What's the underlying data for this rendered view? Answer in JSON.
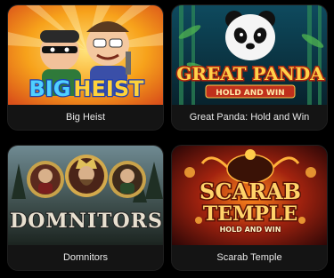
{
  "games": [
    {
      "title": "Big Heist",
      "logo_line1": "BIG",
      "logo_line2": "HEIST",
      "thumb_icon": "big-heist-art"
    },
    {
      "title": "Great Panda: Hold and Win",
      "logo_line1": "GREAT PANDA",
      "logo_line2": "HOLD AND WIN",
      "thumb_icon": "great-panda-art"
    },
    {
      "title": "Domnitors",
      "logo_line1": "DOMNITORS",
      "thumb_icon": "domnitors-art"
    },
    {
      "title": "Scarab Temple",
      "logo_line1": "SCARAB",
      "logo_line2": "TEMPLE",
      "logo_line3": "HOLD AND WIN",
      "thumb_icon": "scarab-temple-art"
    }
  ],
  "colors": {
    "page_bg": "#000000",
    "card_bg": "#141414",
    "caption_text": "#e8e8e8"
  }
}
